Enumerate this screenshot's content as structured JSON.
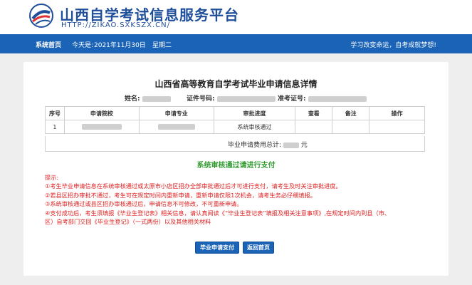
{
  "header": {
    "site_title": "山西自学考试信息服务平台",
    "site_url": "HTTP://ZIKAO.SXKSZX.CN/"
  },
  "navbar": {
    "home": "系统首页",
    "today_label": "今天是:",
    "today_date": "2021年11月30日",
    "weekday": "星期二",
    "slogan": "学习改变命运，自考成就梦想!"
  },
  "page": {
    "title": "山西省高等教育自学考试毕业申请信息详情",
    "name_label": "姓名:",
    "id_label": "证件号码:",
    "exam_no_label": "准考证号:"
  },
  "table": {
    "headers": [
      "序号",
      "申请院校",
      "申请专业",
      "审批进度",
      "查看",
      "备注",
      "操作"
    ],
    "rows": [
      {
        "index": "1",
        "progress": "系统审核通过"
      }
    ],
    "fee_label": "毕业申请费用总计:",
    "fee_unit": "元"
  },
  "status_message": "系统审核通过请进行支付",
  "tips": {
    "title": "提示:",
    "lines": [
      "①考生毕业申请信息在系统审核通过或太原市小店区招办全部审批通过后才可进行支付，请考生及时关注审批进度。",
      "②若县区招办审批不通过，考生可在规定时间内重新申请，重新申请仅限1次机会，请考生务必仔细填报。",
      "③系统审核通过或县区招办审核通过后，申请信息不可修改，不可重新申请。",
      "④支付成功后，考生须填报《毕业生登记表》相关信息，请认真阅读《“毕业生登记表”填报及相关注意事项》,在规定时间内到县（市、",
      "区）自考部门交回《毕业生登记》（一式两份）以及其他相关材料"
    ]
  },
  "buttons": {
    "pay": "毕业申请支付",
    "home": "返回首页"
  },
  "colors": {
    "brand_blue": "#1a63b6",
    "success_green": "#2e9a2e",
    "tip_red": "#e02020"
  }
}
